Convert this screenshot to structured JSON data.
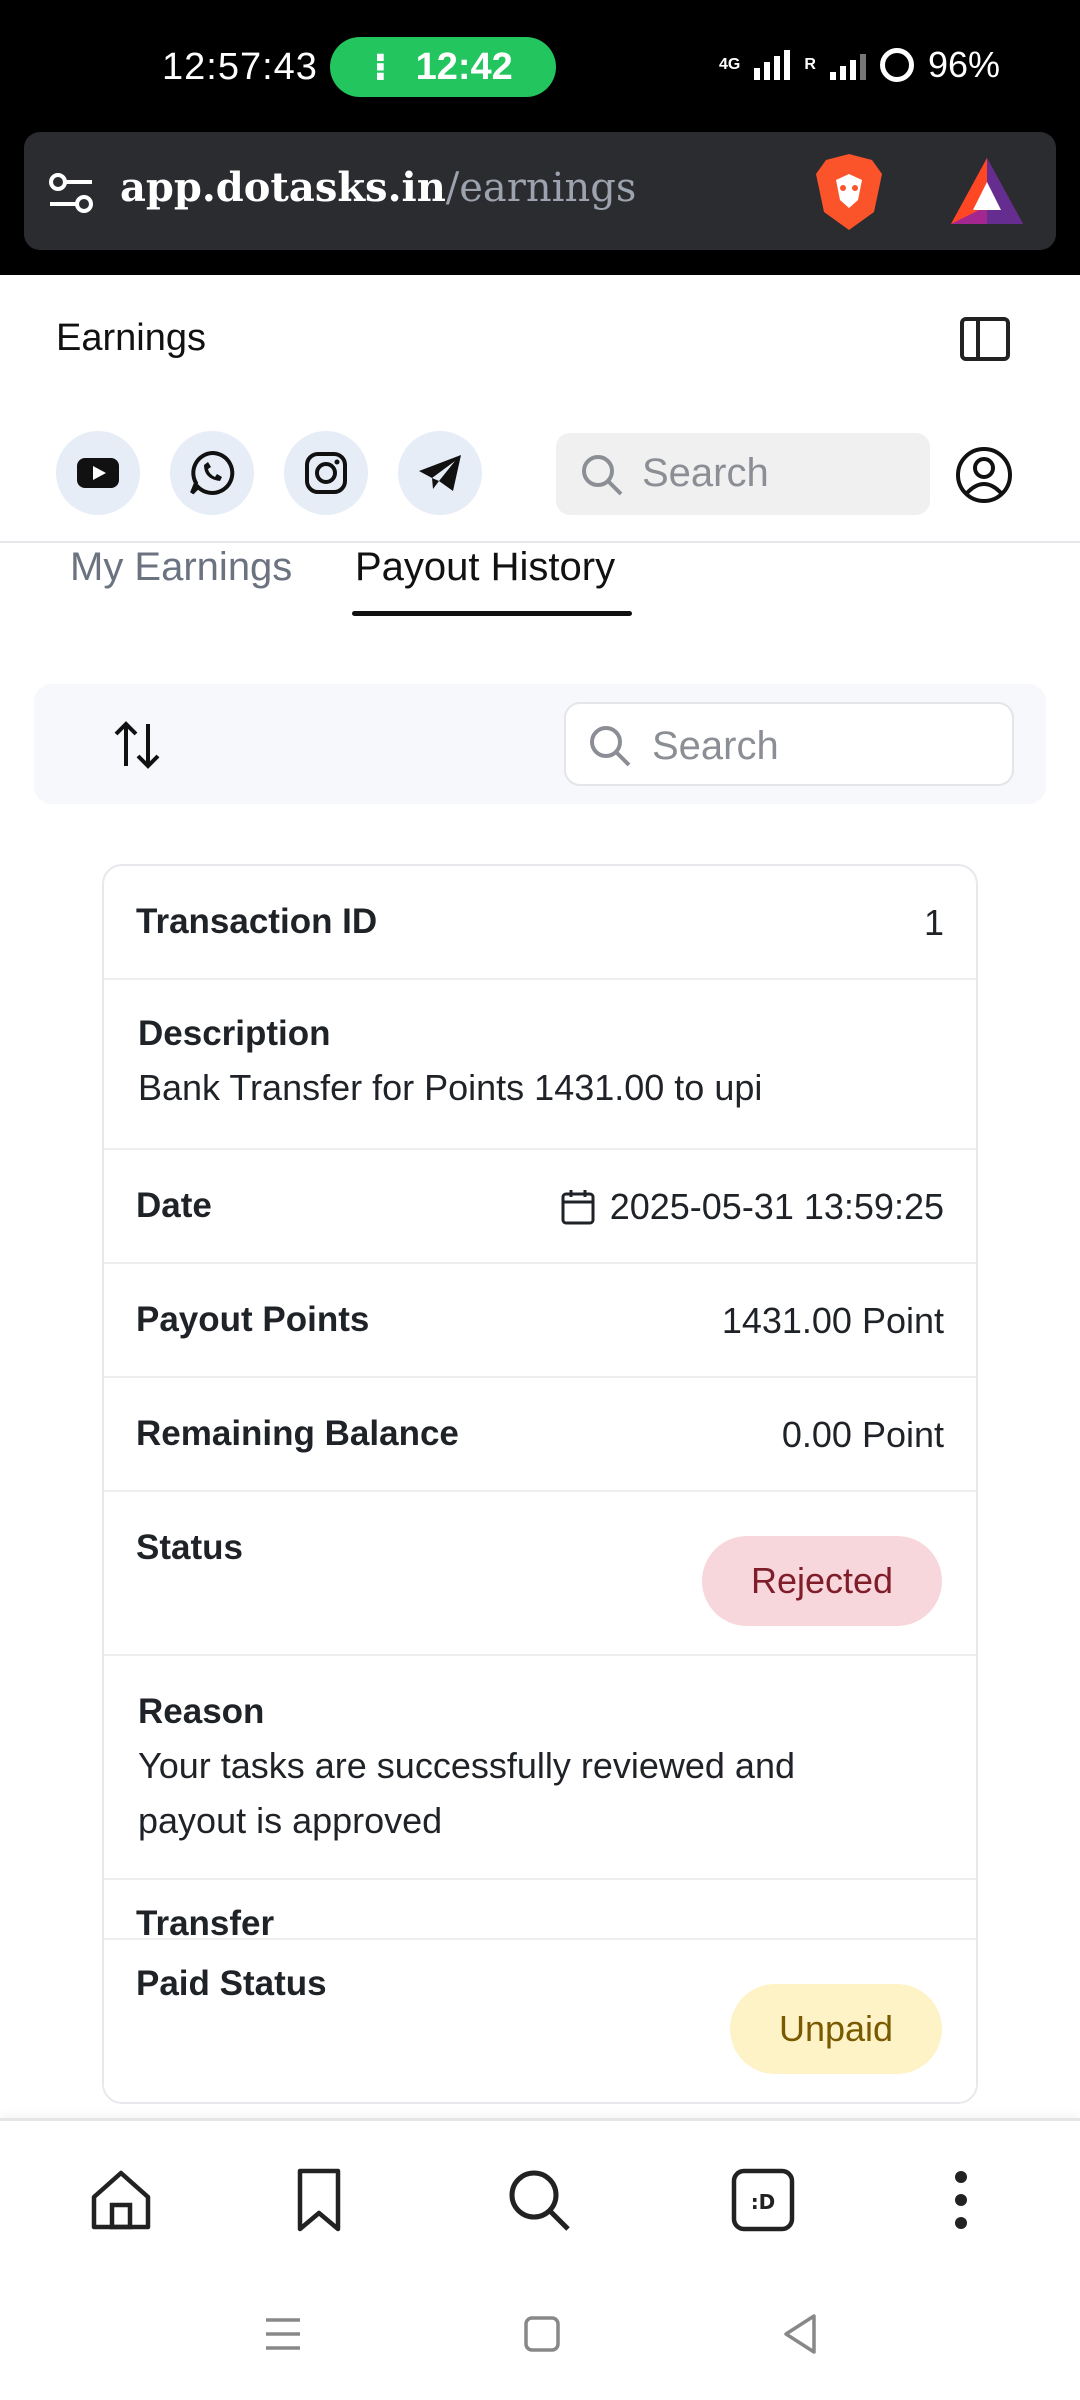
{
  "status_bar": {
    "time": "12:57:43",
    "pill_time": "12:42",
    "network": "4G",
    "roaming": "R",
    "battery": "96%"
  },
  "browser": {
    "url_domain": "app.dotasks.in",
    "url_path": "/earnings"
  },
  "header": {
    "title": "Earnings",
    "search_placeholder": "Search"
  },
  "social_links": [
    "youtube",
    "whatsapp",
    "instagram",
    "telegram"
  ],
  "tabs": [
    {
      "label": "My Earnings",
      "active": false
    },
    {
      "label": "Payout History",
      "active": true
    }
  ],
  "filter": {
    "search_placeholder": "Search"
  },
  "transaction": {
    "id_label": "Transaction ID",
    "id_value": "1",
    "description_label": "Description",
    "description_value": "Bank Transfer for Points 1431.00 to upi",
    "date_label": "Date",
    "date_value": "2025-05-31 13:59:25",
    "payout_label": "Payout Points",
    "payout_value": "1431.00 Point",
    "balance_label": "Remaining Balance",
    "balance_value": "0.00 Point",
    "status_label": "Status",
    "status_value": "Rejected",
    "reason_label": "Reason",
    "reason_line1": "Your tasks are successfully reviewed and",
    "reason_line2": "payout is approved",
    "transfer_label": "Transfer",
    "paid_status_label": "Paid Status",
    "paid_status_value": "Unpaid"
  },
  "colors": {
    "rejected_bg": "#f8d7dc",
    "rejected_text": "#7f1d2a",
    "unpaid_bg": "#fdf3c7",
    "unpaid_text": "#7a5a00",
    "status_pill": "#22c55e"
  }
}
